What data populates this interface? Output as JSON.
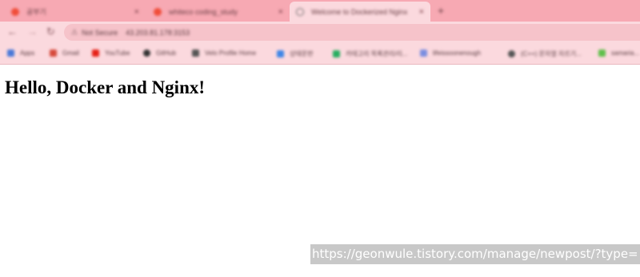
{
  "browser": {
    "tabs": [
      {
        "title": "공부기",
        "active": false,
        "favicon": "tistory-icon"
      },
      {
        "title": "whiteco coding_study",
        "active": false,
        "favicon": "tistory-icon"
      },
      {
        "title": "Welcome to Dockerized Nginx",
        "active": true,
        "favicon": "globe-icon"
      }
    ],
    "close_glyph": "×",
    "new_tab_glyph": "+",
    "address_bar": {
      "security_label": "Not Secure",
      "url": "43.203.81.178:3153"
    },
    "bookmarks": [
      {
        "label": "Apps",
        "icon_color": "#4a79d8"
      },
      {
        "label": "Gmail",
        "icon_color": "#d64a3c"
      },
      {
        "label": "YouTube",
        "icon_color": "#e62117"
      },
      {
        "label": "GitHub",
        "icon_color": "#333333"
      },
      {
        "label": "Velo Profile Home",
        "icon_color": "#555555"
      },
      {
        "label": "상태문판",
        "icon_color": "#3f86e6"
      },
      {
        "label": "카테고리 목록관리/리...",
        "icon_color": "#27ae60"
      },
      {
        "label": "lifeissoonenough",
        "icon_color": "#7b8ee0"
      },
      {
        "label": "(C++) 문자열 자르기...",
        "icon_color": "#555555"
      },
      {
        "label": "samaria...",
        "icon_color": "#5fbf4a"
      }
    ]
  },
  "page": {
    "heading": "Hello, Docker and Nginx!"
  },
  "watermark": {
    "text": "https://geonwule.tistory.com/manage/newpost/?type="
  },
  "colors": {
    "tab_strip": "#f7a9b3",
    "toolbar": "#fbd9de",
    "omnibox": "#f6c3ca",
    "watermark_bg": "#c8c8c8"
  }
}
